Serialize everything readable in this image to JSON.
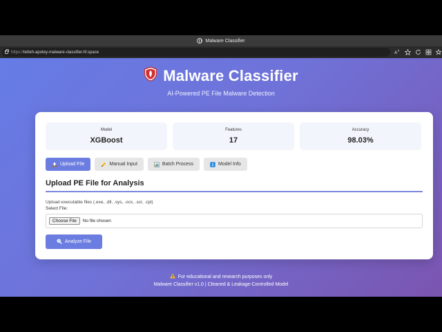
{
  "browser": {
    "window_title": "Malware Classifier",
    "url_prefix": "https://",
    "url_host": "tetteh-apotey-malware-classifier.hf.space"
  },
  "header": {
    "title": "Malware Classifier",
    "subtitle": "AI-Powered PE File Malware Detection"
  },
  "stats": [
    {
      "label": "Model",
      "value": "XGBoost"
    },
    {
      "label": "Features",
      "value": "17"
    },
    {
      "label": "Accuracy",
      "value": "98.03%"
    }
  ],
  "tabs": [
    {
      "label": "Upload File",
      "icon": "upload-icon",
      "active": true
    },
    {
      "label": "Manual Input",
      "icon": "pencil-icon",
      "active": false
    },
    {
      "label": "Batch Process",
      "icon": "bar-chart-icon",
      "active": false
    },
    {
      "label": "Model Info",
      "icon": "info-icon",
      "active": false
    }
  ],
  "upload": {
    "section_title": "Upload PE File for Analysis",
    "help_text": "Upload executable files (.exe, .dll, .sys, .ocx, .scr, .cpl)",
    "field_label": "Select File:",
    "choose_label": "Choose File",
    "file_status": "No file chosen",
    "analyze_label": "Analyze File"
  },
  "footer": {
    "disclaimer": "For educational and research purposes only",
    "version_line": "Malware Classifier v1.0 | Cleaned & Leakage-Controlled Model"
  },
  "colors": {
    "accent": "#6b7de0",
    "gradient_start": "#667ce6",
    "gradient_end": "#7b55b0",
    "shield_red": "#d32f2f"
  }
}
